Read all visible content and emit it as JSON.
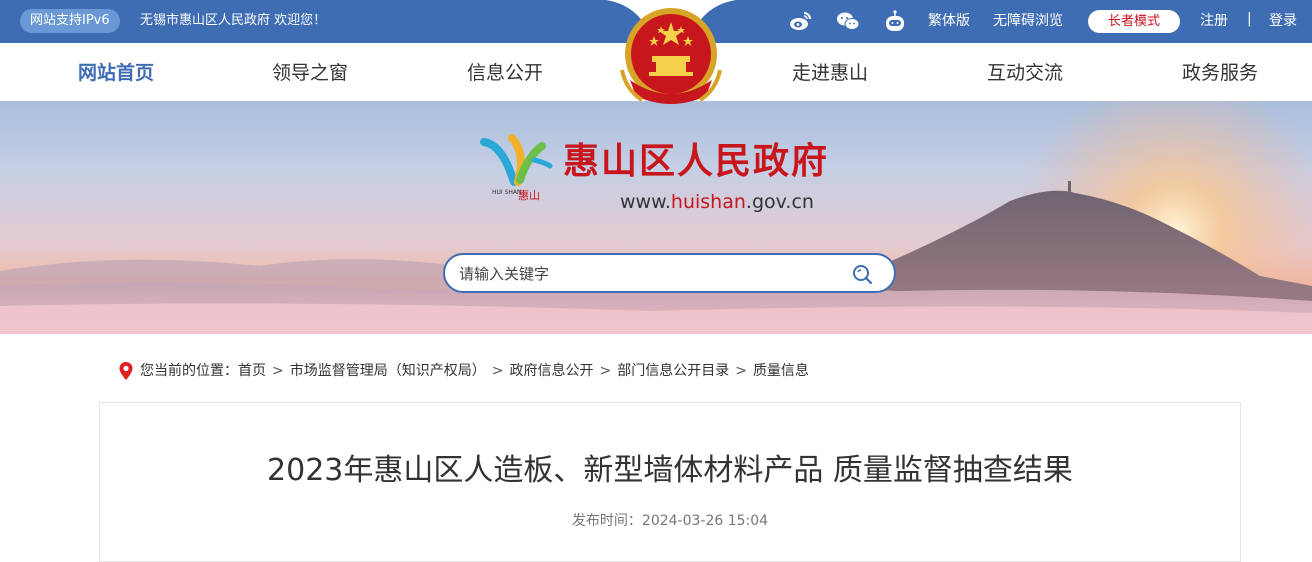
{
  "topbar": {
    "ipv6_badge": "网站支持IPv6",
    "welcome": "无锡市惠山区人民政府 欢迎您！",
    "icons": [
      "weibo-icon",
      "wechat-icon",
      "robot-icon"
    ],
    "traditional": "繁体版",
    "accessible": "无障碍浏览",
    "elder_mode": "长者模式",
    "register": "注册",
    "separator": "|",
    "login": "登录"
  },
  "nav": {
    "items": [
      "网站首页",
      "领导之窗",
      "信息公开",
      "走进惠山",
      "互动交流",
      "政务服务"
    ],
    "active_index": 0
  },
  "banner": {
    "title": "惠山区人民政府",
    "url_prefix": "www.",
    "url_highlight": "huishan",
    "url_suffix": ".gov.cn",
    "logo_text_en": "HUI SHAN",
    "logo_text_cn": "惠山"
  },
  "search": {
    "placeholder": "请输入关键字"
  },
  "breadcrumb": {
    "prefix": "您当前的位置：",
    "items": [
      "首页",
      "市场监督管理局（知识产权局）",
      "政府信息公开",
      "部门信息公开目录",
      "质量信息"
    ],
    "separator": ">"
  },
  "article": {
    "title": "2023年惠山区人造板、新型墙体材料产品 质量监督抽查结果",
    "publish_label": "发布时间：",
    "publish_time": "2024-03-26 15:04"
  },
  "colors": {
    "primary": "#3f6db3",
    "brand_red": "#c8161d"
  }
}
